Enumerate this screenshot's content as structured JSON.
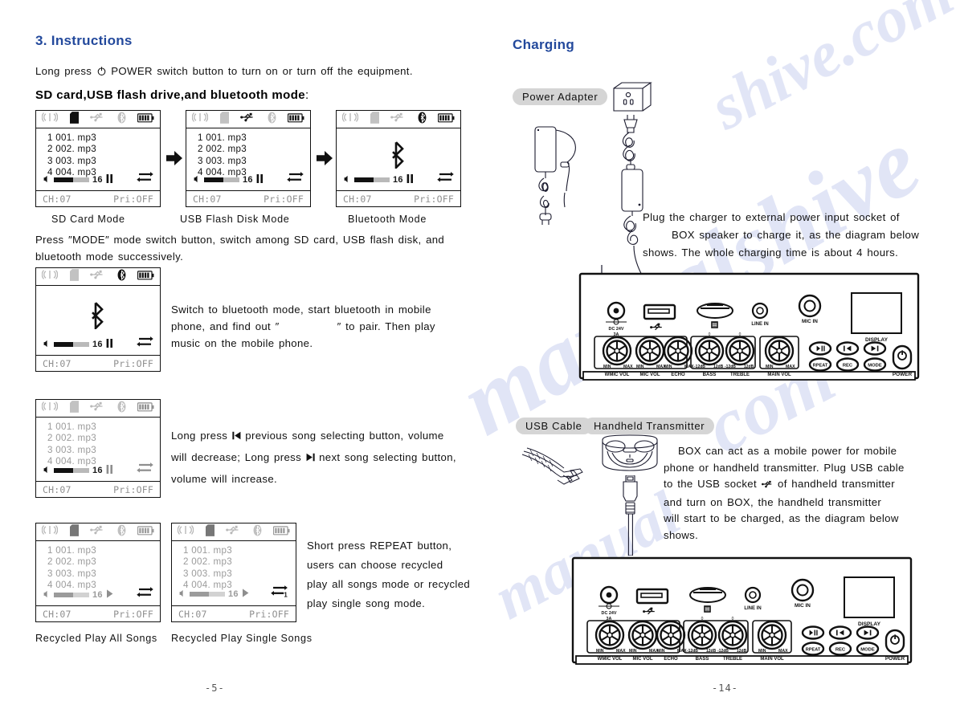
{
  "document": {
    "left_page_number": "-5-",
    "right_page_number": "-14-",
    "accent_color": "#23499c"
  },
  "left": {
    "section_title": "3. Instructions",
    "intro_before": "Long press",
    "intro_power_icon": "power-icon",
    "intro_after": "POWER switch button to turn on or turn off the equipment.",
    "subhead": "SD card,USB flash drive,and bluetooth mode",
    "subhead_colon": ":",
    "screens_row1": [
      {
        "caption": "SD Card Mode",
        "status": {
          "signal": "off",
          "sdcard": "on",
          "usb": "off",
          "bluetooth": "off",
          "battery": "on"
        },
        "tracks": [
          "1  001. mp3",
          "2  002. mp3",
          "3  003. mp3",
          "4  004. mp3"
        ],
        "tracks_dim": false,
        "volume": "16",
        "volume_fill_pct": 55,
        "transport": "pause",
        "repeat": "repeat-all",
        "footer_left": "CH:07",
        "footer_right": "Pri:OFF"
      },
      {
        "caption": "USB Flash Disk Mode",
        "status": {
          "signal": "off",
          "sdcard": "off",
          "usb": "on",
          "bluetooth": "off",
          "battery": "on"
        },
        "tracks": [
          "1  001. mp3",
          "2  002. mp3",
          "3  003. mp3",
          "4  004. mp3"
        ],
        "tracks_dim": false,
        "volume": "16",
        "volume_fill_pct": 55,
        "transport": "pause",
        "repeat": "repeat-all",
        "footer_left": "CH:07",
        "footer_right": "Pri:OFF"
      },
      {
        "caption": "Bluetooth Mode",
        "status": {
          "signal": "off",
          "sdcard": "off",
          "usb": "off",
          "bluetooth": "on",
          "battery": "on"
        },
        "tracks": [],
        "big_icon": "bluetooth-icon",
        "volume": "16",
        "volume_fill_pct": 55,
        "transport": "pause",
        "repeat": "repeat-all",
        "footer_left": "CH:07",
        "footer_right": "Pri:OFF"
      }
    ],
    "mode_para": "Press ″MODE″ mode switch button, switch among SD card, USB flash disk, and bluetooth mode successively.",
    "bt_screen": {
      "status": {
        "signal": "off",
        "sdcard": "off",
        "usb": "off",
        "bluetooth": "on",
        "battery": "on"
      },
      "big_icon": "bluetooth-icon",
      "volume": "16",
      "volume_fill_pct": 55,
      "transport": "pause",
      "repeat": "repeat-all",
      "footer_left": "CH:07",
      "footer_right": "Pri:OFF"
    },
    "bt_para_line1": "Switch to bluetooth mode, start bluetooth in mobile",
    "bt_para_line2_a": "phone, and find out ″",
    "bt_para_line2_b": "″ to pair. Then play",
    "bt_para_line3": "music on the mobile phone.",
    "vol_screen": {
      "status": {
        "signal": "off",
        "sdcard": "off",
        "usb": "off",
        "bluetooth": "off",
        "battery": "off"
      },
      "tracks": [
        "1  001. mp3",
        "2  002. mp3",
        "3  003. mp3",
        "4  004. mp3"
      ],
      "tracks_dim": true,
      "volume": "16",
      "volume_fill_pct": 55,
      "transport": "pause",
      "repeat": "repeat-all",
      "footer_left": "CH:07",
      "footer_right": "Pri:OFF"
    },
    "vol_para_line1_a": "Long press",
    "vol_para_line1_icon": "previous-track-icon",
    "vol_para_line1_b": "previous song selecting button, volume",
    "vol_para_line2_a": "will decrease; Long press",
    "vol_para_line2_icon": "next-track-icon",
    "vol_para_line2_b": "next song selecting button,",
    "vol_para_line3": "volume will increase.",
    "repeat_screens": [
      {
        "caption": "Recycled Play All Songs",
        "status": {
          "signal": "off",
          "sdcard": "on",
          "usb": "off",
          "bluetooth": "off",
          "battery": "off"
        },
        "tracks": [
          "1  001. mp3",
          "2  002. mp3",
          "3  003. mp3",
          "4  004. mp3"
        ],
        "tracks_dim": true,
        "volume": "16",
        "volume_fill_pct": 55,
        "transport": "play",
        "repeat": "repeat-all",
        "footer_left": "CH:07",
        "footer_right": "Pri:OFF"
      },
      {
        "caption": "Recycled Play Single Songs",
        "status": {
          "signal": "off",
          "sdcard": "on",
          "usb": "off",
          "bluetooth": "off",
          "battery": "off"
        },
        "tracks": [
          "1  001. mp3",
          "2  002. mp3",
          "3  003. mp3",
          "4  004. mp3"
        ],
        "tracks_dim": true,
        "volume": "16",
        "volume_fill_pct": 55,
        "transport": "play",
        "repeat": "repeat-one",
        "footer_left": "CH:07",
        "footer_right": "Pri:OFF"
      }
    ],
    "repeat_para_line1": "Short press REPEAT button,",
    "repeat_para_line2": "users can choose recycled",
    "repeat_para_line3": "play all songs mode or recycled",
    "repeat_para_line4": "play single song mode."
  },
  "right": {
    "section_title": "Charging",
    "power_adapter_label": "Power Adapter",
    "charge_para_line1": "Plug the charger to external power input socket of",
    "charge_para_line2": "BOX speaker to charge it, as the diagram below",
    "charge_para_line3": "shows. The whole charging time is about 4 hours.",
    "usb_cable_label": "USB Cable",
    "handheld_label": "Handheld Transmitter",
    "usb_para_line1": "BOX can act as a mobile power for mobile",
    "usb_para_line2": "phone or handheld transmitter. Plug USB cable",
    "usb_para_line3_a": "to the USB socket",
    "usb_para_line3_icon": "usb-icon",
    "usb_para_line3_b": "of handheld transmitter",
    "usb_para_line4": "and turn on BOX, the handheld transmitter",
    "usb_para_line5": "will start to be charged, as the diagram below",
    "usb_para_line6": "shows.",
    "panel": {
      "dc_label_line1": "DC 24V",
      "dc_label_line2": "3A",
      "usb_port_icon": "usb-icon",
      "line_in_label": "LINE IN",
      "mic_in_label": "MIC IN",
      "display_label": "DISPLAY",
      "knobs": [
        {
          "label": "WMIC VOL",
          "min": "MIN",
          "max": "MAX"
        },
        {
          "label": "MIC VOL",
          "min": "MIN",
          "max": "MAX"
        },
        {
          "label": "ECHO",
          "min": "MIN",
          "max": "MAX"
        },
        {
          "label": "BASS",
          "min": "-12dB",
          "max": "12dB"
        },
        {
          "label": "TREBLE",
          "min": "-12dB",
          "max": "12dB"
        },
        {
          "label": "MAIN VOL",
          "min": "MIN",
          "max": "MAX"
        }
      ],
      "buttons": [
        "▶‖",
        "▌◀",
        "▶▌",
        "RPEAT",
        "REC",
        "MODE"
      ],
      "power_label": "POWER"
    }
  },
  "watermark": [
    "shive.com",
    "manualshive",
    "com",
    "manual"
  ]
}
